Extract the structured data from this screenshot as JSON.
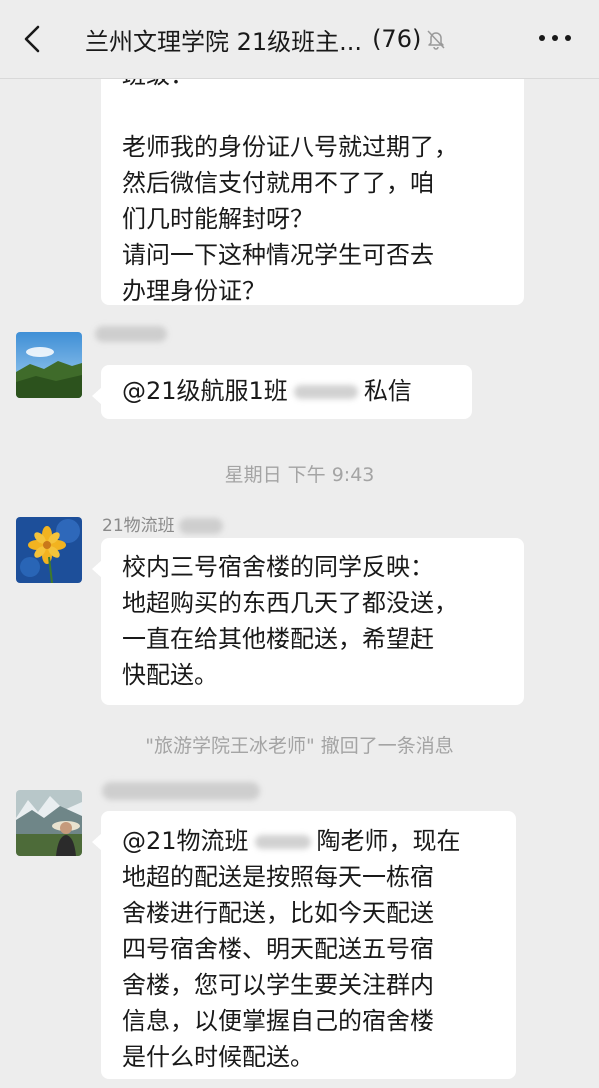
{
  "header": {
    "title": "兰州文理学院 21级班主...",
    "member_count": "(76)",
    "back_icon": "chevron-left-icon",
    "mute_icon": "bell-off-icon",
    "more_icon": "more-dots-icon"
  },
  "messages": [
    {
      "lines": [
        "班级：",
        "",
        "老师我的身份证八号就过期了，",
        "然后微信支付就用不了了，咱",
        "们几时能解封呀？",
        "请问一下这种情况学生可否去",
        "办理身份证？"
      ]
    },
    {
      "lines_parts": [
        "@21级航服1班",
        "私信"
      ]
    },
    {
      "time": "星期日 下午 9:43"
    },
    {
      "sender": "21物流班",
      "lines": [
        "校内三号宿舍楼的同学反映：",
        "地超购买的东西几天了都没送，",
        "一直在给其他楼配送，希望赶",
        "快配送。"
      ]
    },
    {
      "system": "\"旅游学院王冰老师\" 撤回了一条消息"
    },
    {
      "lines_first_parts": [
        "@21物流班",
        "陶老师，现在"
      ],
      "lines": [
        "地超的配送是按照每天一栋宿",
        "舍楼进行配送，比如今天配送",
        "四号宿舍楼、明天配送五号宿",
        "舍楼，您可以学生要关注群内",
        "信息，以便掌握自己的宿舍楼",
        "是什么时候配送。"
      ]
    }
  ]
}
